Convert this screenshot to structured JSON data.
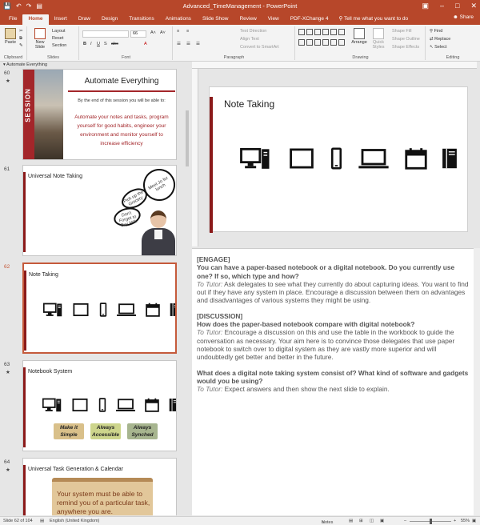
{
  "window": {
    "title": "Advanced_TimeManagement - PowerPoint",
    "qa_icons": [
      "save-icon",
      "undo-icon",
      "redo-icon",
      "present-icon"
    ]
  },
  "tabs": [
    "File",
    "Home",
    "Insert",
    "Draw",
    "Design",
    "Transitions",
    "Animations",
    "Slide Show",
    "Review",
    "View",
    "PDF-XChange 4"
  ],
  "active_tab": "Home",
  "tell_me": "Tell me what you want to do",
  "share_label": "Share",
  "ribbon": {
    "clipboard": {
      "paste": "Paste",
      "label": "Clipboard"
    },
    "slides": {
      "new_slide": "New Slide",
      "layout": "Layout",
      "reset": "Reset",
      "section": "Section",
      "label": "Slides"
    },
    "font": {
      "size": "66",
      "label": "Font"
    },
    "paragraph": {
      "text_direction": "Text Direction",
      "align_text": "Align Text",
      "convert_smartart": "Convert to SmartArt",
      "label": "Paragraph"
    },
    "drawing": {
      "arrange": "Arrange",
      "quick_styles": "Quick Styles",
      "shape_fill": "Shape Fill",
      "shape_outline": "Shape Outline",
      "shape_effects": "Shape Effects",
      "label": "Drawing"
    },
    "editing": {
      "find": "Find",
      "replace": "Replace",
      "select": "Select",
      "label": "Editing"
    }
  },
  "section_name": "Automate Everything",
  "slides": [
    {
      "number": "60",
      "title": "Automate Everything",
      "side_word": "SESSION",
      "subtitle": "By the end of this session you will be able to:",
      "body": "Automate your notes and tasks, program yourself for good habits, engineer your environment and monitor yourself to increase efficiency"
    },
    {
      "number": "61",
      "title": "Universal Note Taking",
      "bubble1": "Pick up the Grocery",
      "bubble2": "Meet Jo for lunch",
      "bubble3": "Don't Forget to Buy Milk"
    },
    {
      "number": "62",
      "title": "Note Taking"
    },
    {
      "number": "63",
      "title": "Notebook System",
      "pills": [
        "Make it Simple",
        "Always Accessible",
        "Always Synched"
      ]
    },
    {
      "number": "64",
      "title": "Universal Task Generation & Calendar",
      "scroll_text": "Your system must be able to remind you of a particular task, anywhere you are."
    }
  ],
  "current_slide": {
    "title": "Note Taking"
  },
  "device_icons": [
    "desktop-icon",
    "monitor-icon",
    "phone-icon",
    "laptop-icon",
    "calendar-icon",
    "notebook-icon"
  ],
  "notes": {
    "engage_tag": "[ENGAGE]",
    "engage_question": "You can have a paper-based notebook or a digital notebook. Do you currently use one? If so, which type and how?",
    "engage_tutor_label": "To Tutor:",
    "engage_tutor": "Ask delegates to see what they currently do about capturing ideas. You want to find out if they have any system in place. Encourage a discussion between them on advantages and disadvantages of various systems they might be using.",
    "discussion_tag": "[DISCUSSION]",
    "discussion_question": "How does the paper-based notebook compare with digital notebook?",
    "discussion_tutor_label": "To Tutor:",
    "discussion_tutor": "Encourage a discussion on this and use the table in the workbook to guide the conversation as necessary. Your aim here is to convince those delegates that use paper notebook to switch over to digital system as they are vastly more superior and will undoubtedly get better and better in the future.",
    "digital_question": "What does a digital note taking system consist of? What kind of software and gadgets would you be using?",
    "digital_tutor_label": "To Tutor:",
    "digital_tutor": "Expect answers and then show the next slide to explain."
  },
  "status": {
    "slide_of": "Slide 62 of 104",
    "language": "English (United Kingdom)",
    "notes": "Notes",
    "zoom": "55%"
  },
  "colors": {
    "accent": "#b7472a",
    "slide_accent": "#8b1a1a",
    "pill_1": "#d9c08a",
    "pill_2": "#cdd58c",
    "pill_3": "#a7b58f"
  }
}
